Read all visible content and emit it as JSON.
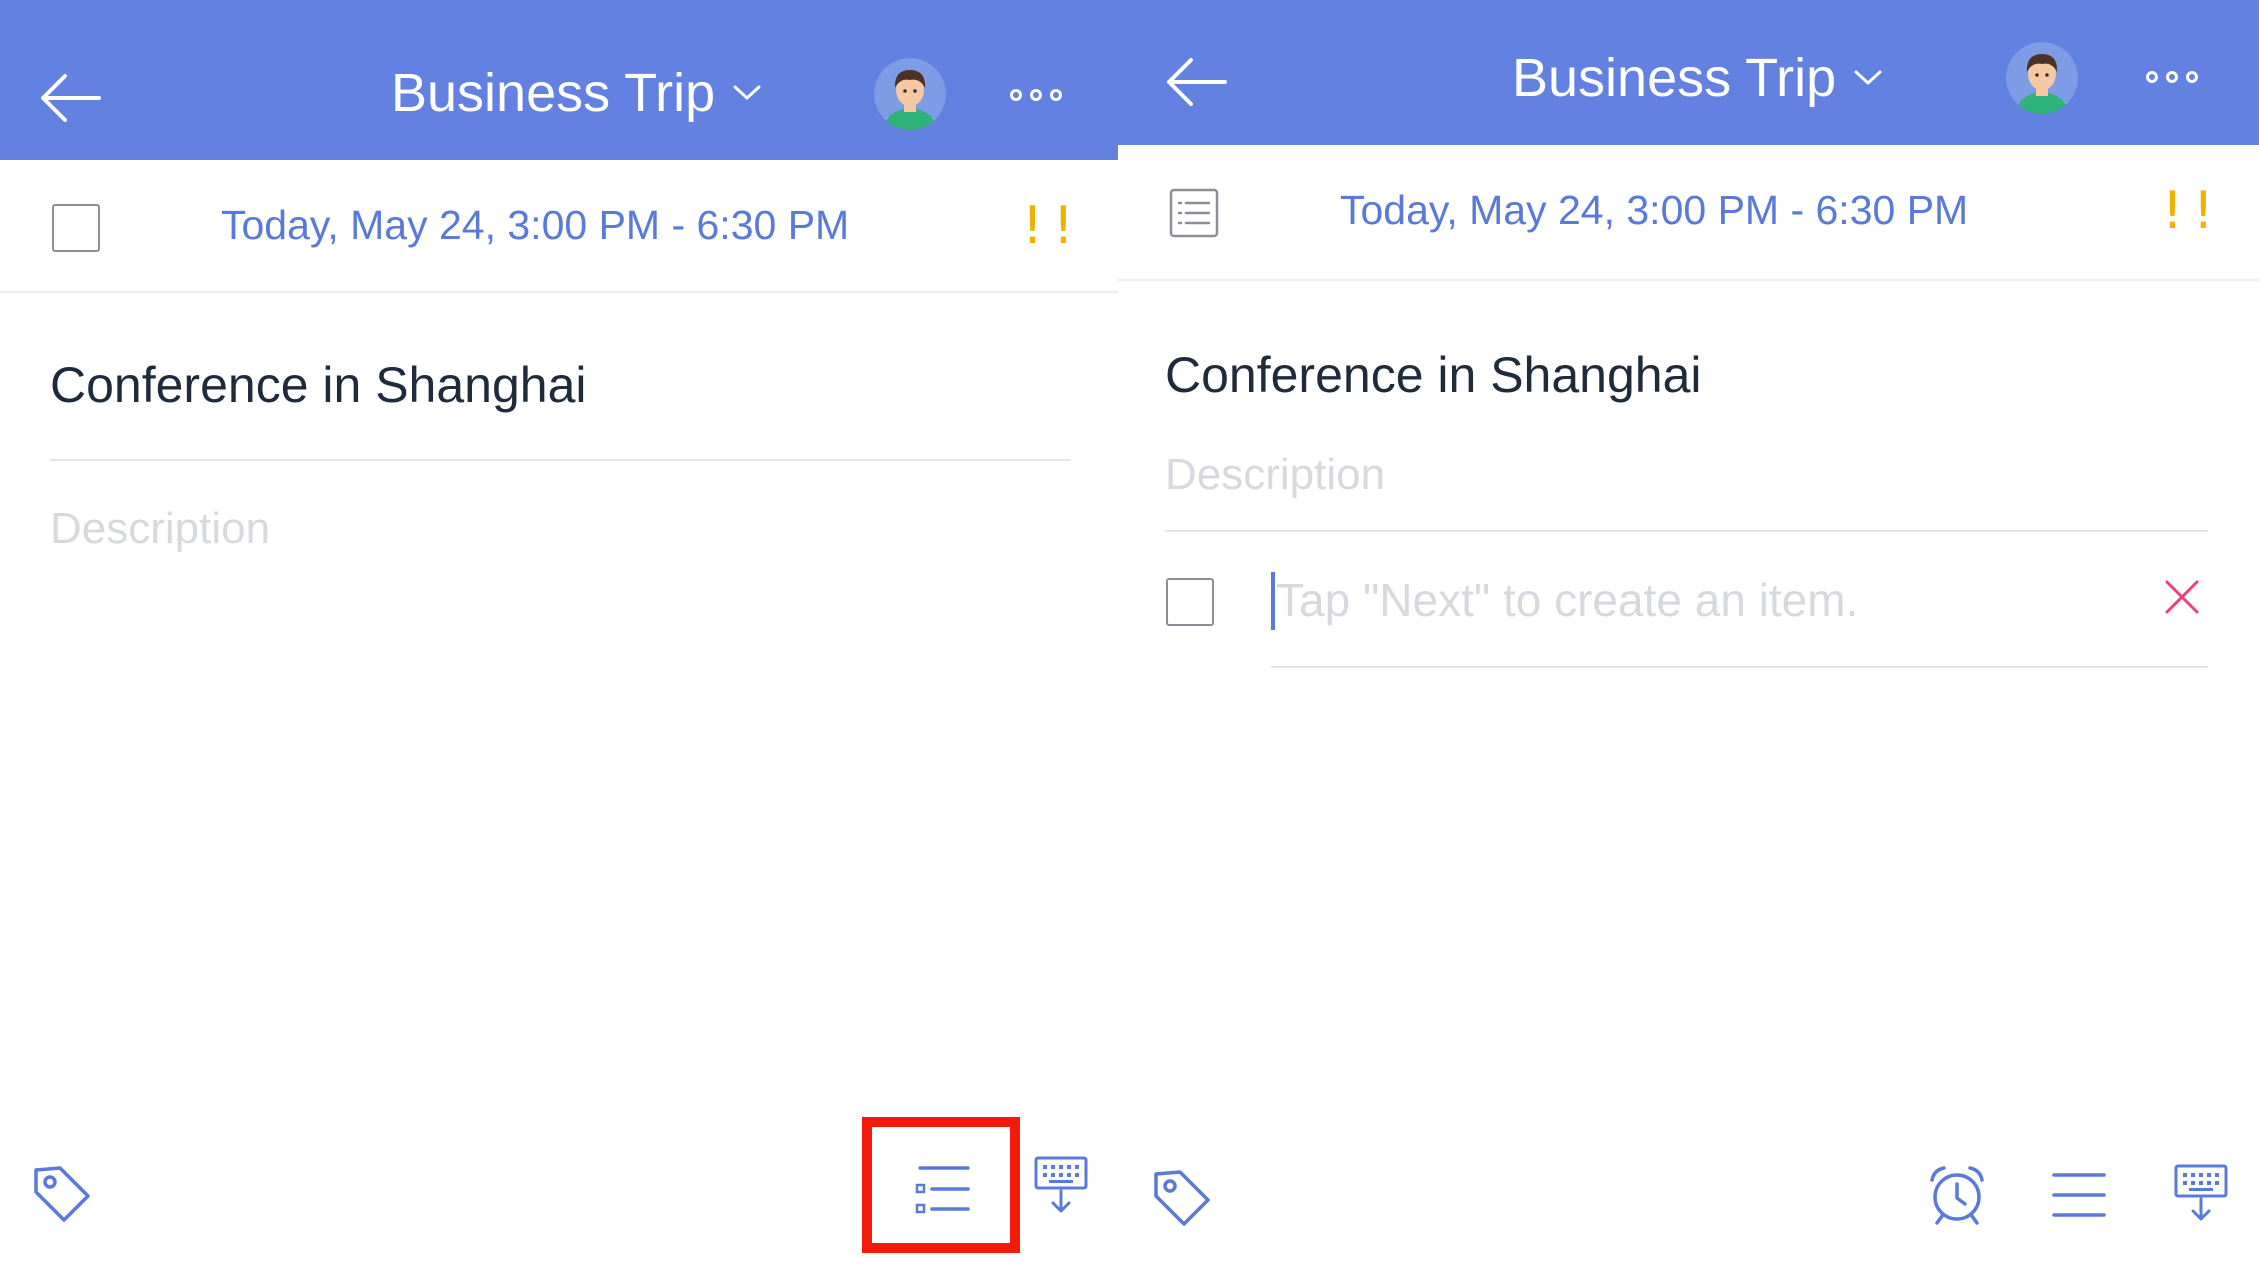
{
  "left": {
    "header": {
      "title": "Business Trip"
    },
    "date_row": {
      "datetime": "Today, May 24, 3:00 PM - 6:30 PM",
      "priority": "!!"
    },
    "task": {
      "title": "Conference in Shanghai",
      "description_placeholder": "Description"
    },
    "toolbar": {
      "tag_icon": "tag-icon",
      "checklist_icon": "checklist-icon",
      "keyboard_icon": "keyboard-dismiss-icon"
    },
    "highlighted": "checklist-button"
  },
  "right": {
    "header": {
      "title": "Business Trip"
    },
    "date_row": {
      "datetime": "Today, May 24, 3:00 PM - 6:30 PM",
      "priority": "!!"
    },
    "task": {
      "title": "Conference in Shanghai",
      "description_placeholder": "Description"
    },
    "checklist": {
      "item_placeholder": "Tap \"Next\" to create an item."
    },
    "toolbar": {
      "tag_icon": "tag-icon",
      "alarm_icon": "alarm-icon",
      "text_icon": "text-lines-icon",
      "keyboard_icon": "keyboard-dismiss-icon"
    }
  },
  "colors": {
    "header": "#6281e0",
    "accent": "#5b79d8",
    "priority": "#f2b100",
    "delete": "#f0407a",
    "highlight": "#f21b0a"
  }
}
